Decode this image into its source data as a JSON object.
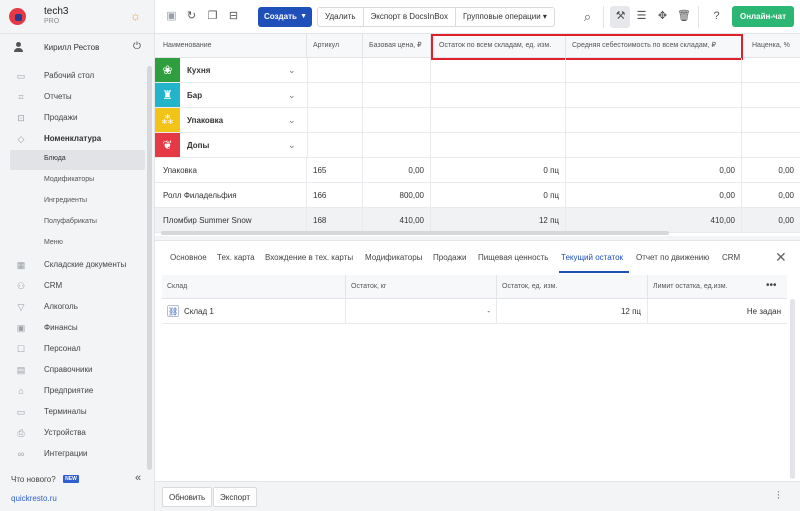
{
  "brand": {
    "name": "tech3",
    "plan": "PRO"
  },
  "user": {
    "name": "Кирилл Рестов"
  },
  "nav": {
    "items": [
      {
        "label": "Рабочий стол",
        "icon": "desktop-icon"
      },
      {
        "label": "Отчеты",
        "icon": "chart-icon"
      },
      {
        "label": "Продажи",
        "icon": "cart-icon"
      },
      {
        "label": "Номенклатура",
        "icon": "tag-icon"
      },
      {
        "label": "Блюда",
        "icon": ""
      },
      {
        "label": "Модификаторы",
        "icon": ""
      },
      {
        "label": "Ингредиенты",
        "icon": ""
      },
      {
        "label": "Полуфабрикаты",
        "icon": ""
      },
      {
        "label": "Меню",
        "icon": ""
      },
      {
        "label": "Складские документы",
        "icon": "warehouse-icon"
      },
      {
        "label": "CRM",
        "icon": "people-icon"
      },
      {
        "label": "Алкоголь",
        "icon": "glass-icon"
      },
      {
        "label": "Финансы",
        "icon": "money-icon"
      },
      {
        "label": "Персонал",
        "icon": "staff-icon"
      },
      {
        "label": "Справочники",
        "icon": "book-icon"
      },
      {
        "label": "Предприятие",
        "icon": "store-icon"
      },
      {
        "label": "Терминалы",
        "icon": "terminal-icon"
      },
      {
        "label": "Устройства",
        "icon": "printer-icon"
      },
      {
        "label": "Интеграции",
        "icon": "link-icon"
      }
    ],
    "whats_new": "Что нового?",
    "new_badge": "NEW",
    "site": "quickresto.ru"
  },
  "toolbar": {
    "create": "Создать",
    "delete": "Удалить",
    "export": "Экспорт в DocsInBox",
    "group_ops": "Групповые операции",
    "chat": "Онлайн-чат"
  },
  "grid": {
    "columns": [
      "Наименование",
      "Артикул",
      "Базовая цена, ₽",
      "Остаток по всем складам, ед. изм.",
      "Средняя себестоимость по всем складам, ₽",
      "Наценка, %"
    ],
    "categories": [
      {
        "name": "Кухня",
        "color": "#2e9e3e",
        "icon": "cherry-icon"
      },
      {
        "name": "Бар",
        "color": "#22b5c9",
        "icon": "cup-icon"
      },
      {
        "name": "Упаковка",
        "color": "#f2c41a",
        "icon": "circles-icon"
      },
      {
        "name": "Допы",
        "color": "#e63946",
        "icon": "pepper-icon"
      }
    ],
    "rows": [
      {
        "name": "Упаковка",
        "sku": "165",
        "price": "0,00",
        "stock": "0 пц",
        "cost": "0,00",
        "markup": "0,00"
      },
      {
        "name": "Ролл Филадельфия",
        "sku": "166",
        "price": "800,00",
        "stock": "0 пц",
        "cost": "0,00",
        "markup": "0,00"
      },
      {
        "name": "Пломбир Summer Snow",
        "sku": "168",
        "price": "410,00",
        "stock": "12 пц",
        "cost": "410,00",
        "markup": "0,00"
      }
    ]
  },
  "details": {
    "tabs": [
      "Основное",
      "Тех. карта",
      "Вхождение в тех. карты",
      "Модификаторы",
      "Продажи",
      "Пищевая ценность",
      "Текущий остаток",
      "Отчет по движению",
      "CRM"
    ],
    "active_tab": "Текущий остаток",
    "columns": [
      "Склад",
      "Остаток, кг",
      "Остаток, ед. изм.",
      "Лимит остатка, ед.изм."
    ],
    "row": {
      "warehouse": "Склад 1",
      "stock_kg": "-",
      "stock_units": "12 пц",
      "limit": "Не задан"
    },
    "footer": {
      "refresh": "Обновить",
      "export": "Экспорт"
    }
  }
}
